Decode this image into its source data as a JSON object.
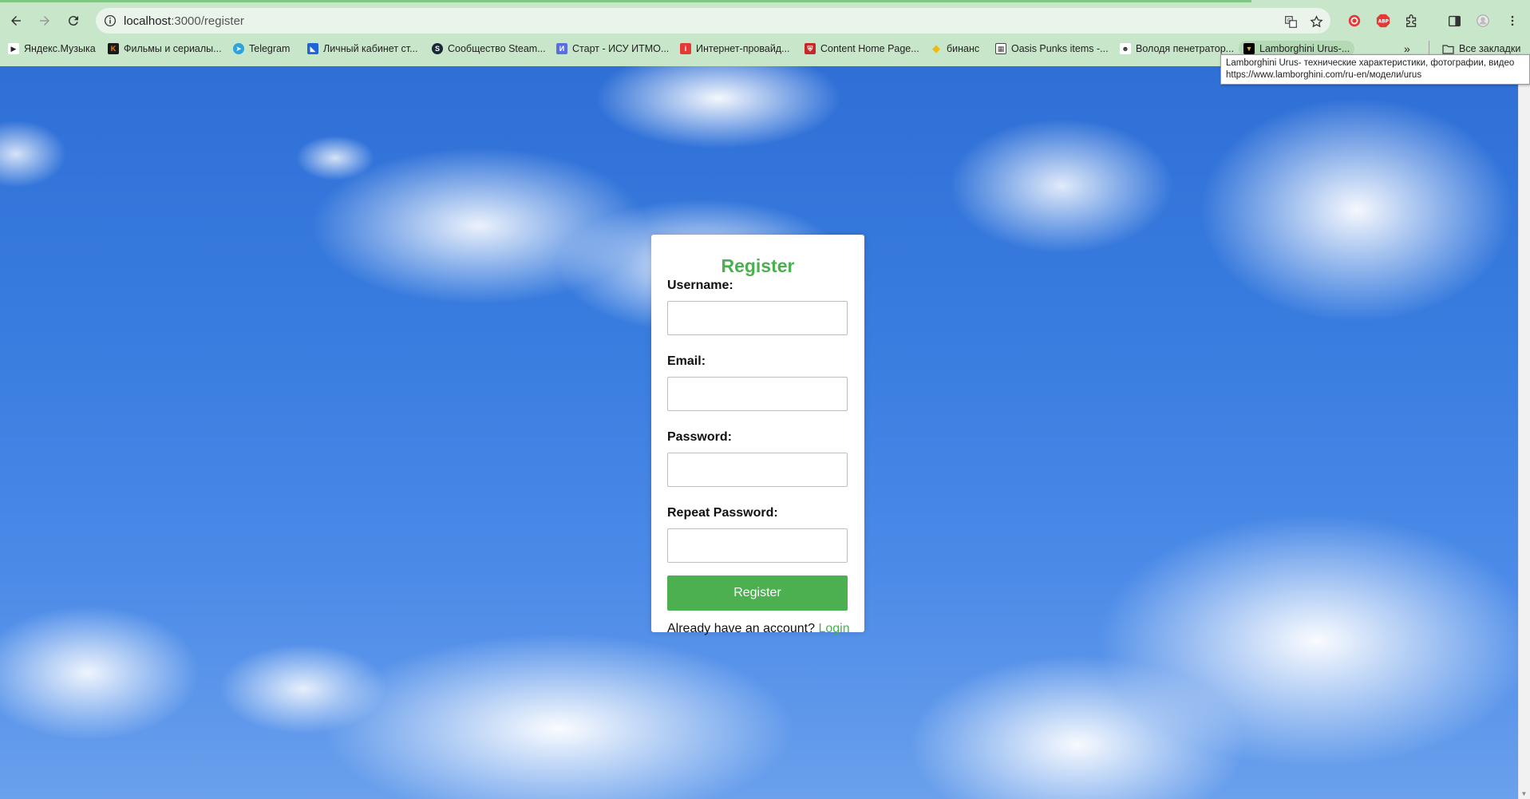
{
  "browser": {
    "url_host": "localhost",
    "url_path": ":3000/register",
    "bookmarks": [
      {
        "label": "Яндекс.Музыка",
        "color": "#222222"
      },
      {
        "label": "Фильмы и сериалы...",
        "color": "#e65100"
      },
      {
        "label": "Telegram",
        "color": "#2aa3df"
      },
      {
        "label": "Личный кабинет ст...",
        "color": "#1e64d8"
      },
      {
        "label": "Сообщество Steam...",
        "color": "#1b2838"
      },
      {
        "label": "Старт - ИСУ ИТМО...",
        "color": "#5b6ee1"
      },
      {
        "label": "Интернет-провайд...",
        "color": "#e53935"
      },
      {
        "label": "Content Home Page...",
        "color": "#c62828"
      },
      {
        "label": "бинанс",
        "color": "#f0b90b"
      },
      {
        "label": "Oasis Punks items -...",
        "color": "#444444"
      },
      {
        "label": "Володя пенетратор...",
        "color": "#333333"
      },
      {
        "label": "Lamborghini Urus-...",
        "color": "#000000"
      }
    ],
    "all_bookmarks_label": "Все закладки",
    "tooltip_line1": "Lamborghini Urus- технические характеристики, фотографии, видео",
    "tooltip_line2": "https://www.lamborghini.com/ru-en/модели/urus"
  },
  "form": {
    "title": "Register",
    "username_label": "Username:",
    "email_label": "Email:",
    "password_label": "Password:",
    "repeat_password_label": "Repeat Password:",
    "username_value": "",
    "email_value": "",
    "password_value": "",
    "repeat_password_value": "",
    "submit_label": "Register",
    "login_prompt": "Already have an account?",
    "login_link": "Login"
  },
  "colors": {
    "accent": "#4caf50",
    "chrome": "#c8e6c9"
  }
}
